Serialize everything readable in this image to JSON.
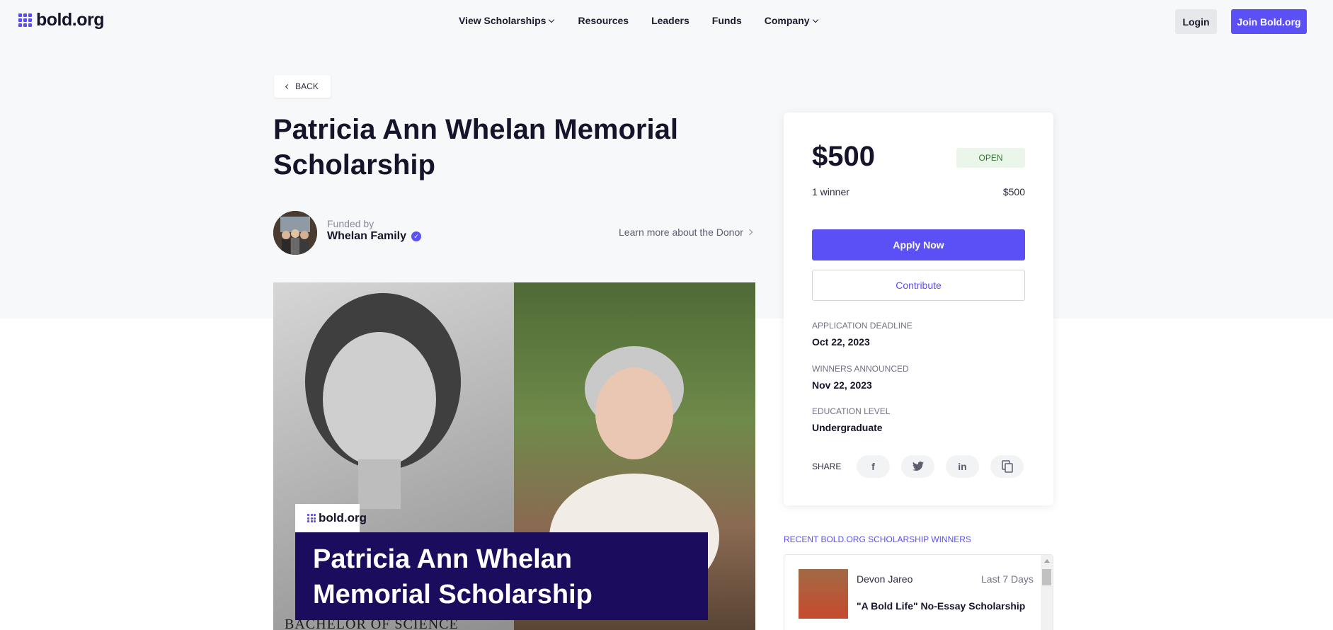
{
  "header": {
    "logo_text": "bold.org",
    "nav": [
      {
        "label": "View Scholarships",
        "has_dropdown": true
      },
      {
        "label": "Resources",
        "has_dropdown": false
      },
      {
        "label": "Leaders",
        "has_dropdown": false
      },
      {
        "label": "Funds",
        "has_dropdown": false
      },
      {
        "label": "Company",
        "has_dropdown": true
      }
    ],
    "login_label": "Login",
    "join_label": "Join Bold.org"
  },
  "back_label": "BACK",
  "title": "Patricia Ann Whelan Memorial Scholarship",
  "funder": {
    "funded_by_label": "Funded by",
    "name": "Whelan Family",
    "donor_link": "Learn more about the Donor"
  },
  "hero": {
    "logo_text": "bold.org",
    "banner_line1": "Patricia Ann Whelan",
    "banner_line2": "Memorial Scholarship",
    "caption": "BACHELOR OF SCIENCE"
  },
  "card": {
    "amount": "$500",
    "status": "OPEN",
    "winners_label": "1 winner",
    "winners_amount": "$500",
    "apply_label": "Apply Now",
    "contribute_label": "Contribute",
    "deadline_label": "APPLICATION DEADLINE",
    "deadline_value": "Oct 22, 2023",
    "announced_label": "WINNERS ANNOUNCED",
    "announced_value": "Nov 22, 2023",
    "education_label": "EDUCATION LEVEL",
    "education_value": "Undergraduate",
    "share_label": "SHARE",
    "share_icons": [
      "facebook-icon",
      "twitter-icon",
      "linkedin-icon",
      "copy-icon"
    ]
  },
  "recent": {
    "title": "RECENT BOLD.ORG SCHOLARSHIP WINNERS",
    "items": [
      {
        "name": "Devon Jareo",
        "time": "Last 7 Days",
        "scholarship": "\"A Bold Life\" No-Essay Scholarship"
      }
    ]
  },
  "colors": {
    "accent": "#5a50f5",
    "banner": "#1c0c5e",
    "open_badge_bg": "#eaf6ea",
    "open_badge_text": "#2f7a30"
  }
}
